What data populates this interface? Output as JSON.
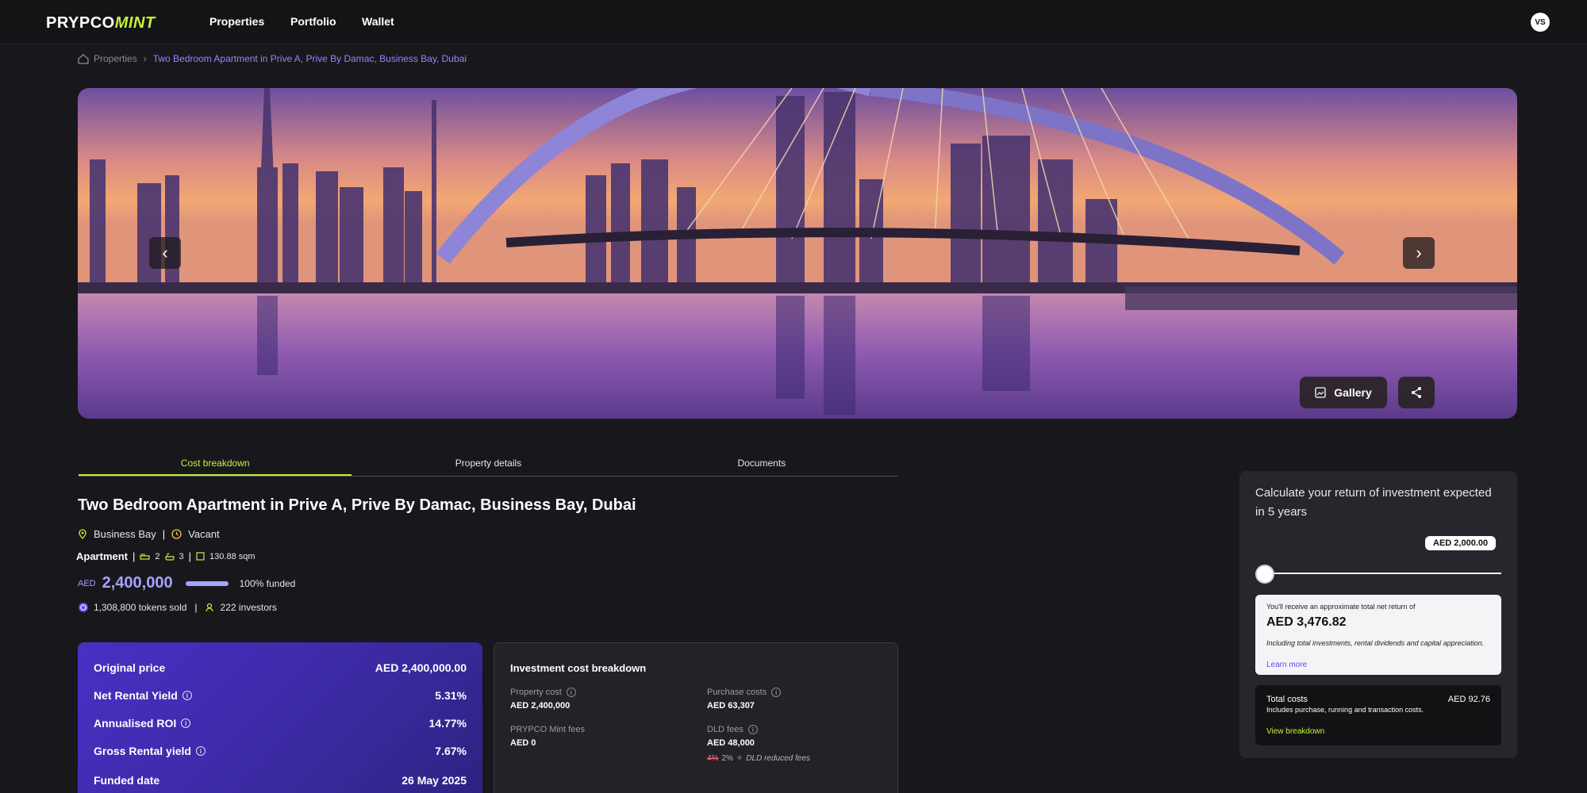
{
  "brand": {
    "part1": "PRYPCO",
    "part2": "MINT"
  },
  "nav": {
    "items": [
      "Properties",
      "Portfolio",
      "Wallet"
    ],
    "avatar": "VS"
  },
  "breadcrumb": {
    "home": "Properties",
    "current": "Two Bedroom Apartment in Prive A, Prive By Damac, Business Bay, Dubai"
  },
  "hero": {
    "gallery_label": "Gallery",
    "prev_icon": "chevron-left-icon",
    "next_icon": "chevron-right-icon"
  },
  "tabs": [
    "Cost breakdown",
    "Property details",
    "Documents"
  ],
  "property": {
    "title": "Two Bedroom Apartment in Prive A, Prive By Damac, Business Bay, Dubai",
    "location": "Business Bay",
    "status": "Vacant",
    "type": "Apartment",
    "bedrooms": "2",
    "bathrooms": "3",
    "area": "130.88 sqm",
    "currency": "AED",
    "price": "2,400,000",
    "funded_fraction": 1.0,
    "funded_label": "100% funded",
    "tokens_sold": "1,308,800 tokens sold",
    "investors": "222 investors"
  },
  "stats": [
    {
      "label": "Original price",
      "value": "AED 2,400,000.00",
      "info": false
    },
    {
      "label": "Net Rental Yield",
      "value": "5.31%",
      "info": true
    },
    {
      "label": "Annualised ROI",
      "value": "14.77%",
      "info": true
    },
    {
      "label": "Gross Rental yield",
      "value": "7.67%",
      "info": true
    },
    {
      "label": "Funded date",
      "value": "26 May 2025",
      "info": false
    }
  ],
  "cost_breakdown": {
    "title": "Investment cost breakdown",
    "items": [
      {
        "label": "Property cost",
        "value": "AED 2,400,000"
      },
      {
        "label": "Purchase costs",
        "value": "AED 63,307"
      },
      {
        "label": "PRYPCO Mint fees",
        "value": "AED 0"
      },
      {
        "label": "DLD fees",
        "value": "AED 48,000"
      }
    ],
    "dld_old": "4%",
    "dld_new": "2%",
    "dld_note": "DLD reduced fees"
  },
  "calculator": {
    "title": "Calculate your return of investment expected in 5 years",
    "amount": "AED 2,000.00",
    "slider_fraction": 0.0,
    "return_intro": "You'll receive an approximate total net return of",
    "return_amount": "AED 3,476.82",
    "return_note": "Including total investments, rental dividends and capital appreciation.",
    "learn_more": "Learn more",
    "total_label": "Total costs",
    "total_amount": "AED 92.76",
    "total_note": "Includes purchase, running and transaction costs.",
    "view_breakdown": "View breakdown"
  },
  "colors": {
    "accent_green": "#c3f23c",
    "accent_purple": "#a7a2ff",
    "card_purple": "#4a2fc4",
    "background": "#18181c"
  }
}
